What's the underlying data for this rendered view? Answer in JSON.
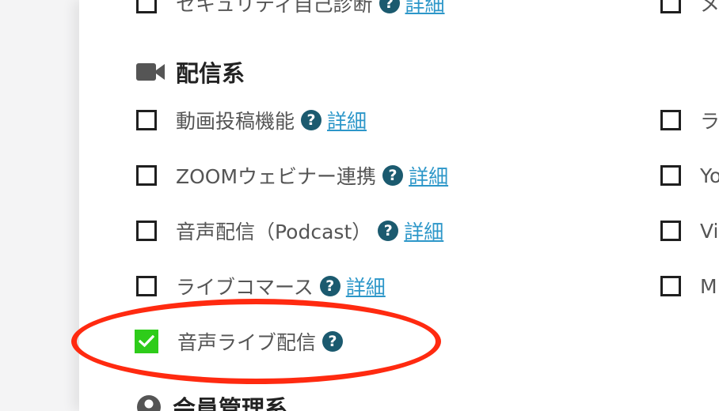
{
  "colors": {
    "link": "#2d97c9",
    "help_icon": "#1b5a6f",
    "checked": "#2ecc1a",
    "highlight": "#ff2a10"
  },
  "top_partial": {
    "label": "セキュリティ自己診断",
    "detail_label": "詳細"
  },
  "distribution_section": {
    "icon": "video-camera-icon",
    "title": "配信系",
    "items": [
      {
        "label": "動画投稿機能",
        "checked": false,
        "has_help": true,
        "detail_label": "詳細"
      },
      {
        "label": "ZOOMウェビナー連携",
        "checked": false,
        "has_help": true,
        "detail_label": "詳細"
      },
      {
        "label": "音声配信（Podcast）",
        "checked": false,
        "has_help": true,
        "detail_label": "詳細"
      },
      {
        "label": "ライブコマース",
        "checked": false,
        "has_help": true,
        "detail_label": "詳細"
      },
      {
        "label": "音声ライブ配信",
        "checked": true,
        "has_help": true,
        "detail_label": ""
      }
    ]
  },
  "right_column_partial": {
    "items": [
      {
        "label": "メ"
      },
      {
        "label": "ラ"
      },
      {
        "label": "Yo"
      },
      {
        "label": "Vi"
      },
      {
        "label": "M"
      }
    ]
  },
  "member_section": {
    "icon": "user-circle-icon",
    "title": "会員管理系"
  },
  "help_glyph": "?"
}
